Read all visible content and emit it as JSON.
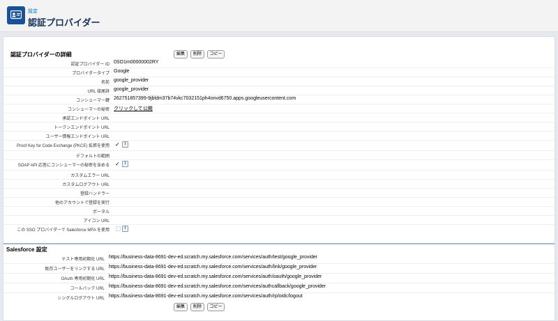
{
  "header": {
    "breadcrumb": "設定",
    "title": "認証プロバイダー"
  },
  "detail": {
    "section_title": "認証プロバイダーの詳細",
    "buttons": {
      "edit": "編集",
      "delete": "削除",
      "copy": "コピー"
    },
    "rows": [
      {
        "label": "認証プロバイダー ID",
        "value": "0SO1m00000002RY"
      },
      {
        "label": "プロバイダータイプ",
        "value": "Google"
      },
      {
        "label": "名前",
        "value": "google_provider"
      },
      {
        "label": "URL 接尾辞",
        "value": "google_provider"
      },
      {
        "label": "コンシューマー鍵",
        "value": "262751857399-9jbldm37b74vkc7032151ph4onvd6750.apps.googleusercontent.com"
      },
      {
        "label": "コンシューマーの秘密",
        "value": "クリックして公開"
      },
      {
        "label": "承認エンドポイント URL",
        "value": ""
      },
      {
        "label": "トークンエンドポイント URL",
        "value": ""
      },
      {
        "label": "ユーザー情報エンドポイント URL",
        "value": ""
      },
      {
        "label": "Proof Key for Code Exchange (PKCE) 拡張を使用",
        "value": "✓"
      },
      {
        "label": "デフォルトの範囲",
        "value": ""
      },
      {
        "label": "SOAP API 応答にコンシューマーの秘密を含める",
        "value": "✓"
      },
      {
        "label": "カスタムエラー URL",
        "value": ""
      },
      {
        "label": "カスタムログアウト URL",
        "value": ""
      },
      {
        "label": "登録ハンドラー",
        "value": ""
      },
      {
        "label": "他のアカウントで登録を実行",
        "value": ""
      },
      {
        "label": "ポータル",
        "value": ""
      },
      {
        "label": "アイコン URL",
        "value": ""
      },
      {
        "label": "この SSO プロバイダーで Salesforce MFA を使用",
        "value": ""
      }
    ],
    "info_icon_text": "i"
  },
  "salesforce": {
    "section_title": "Salesforce 設定",
    "rows": [
      {
        "label": "テスト専用初期化 URL",
        "value": "https://business-data-8691-dev-ed.scratch.my.salesforce.com/services/auth/test/google_provider"
      },
      {
        "label": "既存ユーザーをリンクする URL",
        "value": "https://business-data-8691-dev-ed.scratch.my.salesforce.com/services/auth/link/google_provider"
      },
      {
        "label": "OAuth 専用初期化 URL",
        "value": "https://business-data-8691-dev-ed.scratch.my.salesforce.com/services/auth/oauth/google_provider"
      },
      {
        "label": "コールバック URL",
        "value": "https://business-data-8691-dev-ed.scratch.my.salesforce.com/services/authcallback/google_provider"
      },
      {
        "label": "シングルログアウト URL",
        "value": "https://business-data-8691-dev-ed.scratch.my.salesforce.com/services/auth/rp/oidc/logout"
      }
    ],
    "buttons": {
      "edit": "編集",
      "delete": "削除",
      "copy": "コピー"
    }
  },
  "colors": {
    "header_icon_bg": "#1b5297",
    "link": "#0070d2",
    "page_bg": "#e6e9ed"
  },
  "icons": {
    "header": "id-card-icon",
    "info": "info-icon"
  }
}
